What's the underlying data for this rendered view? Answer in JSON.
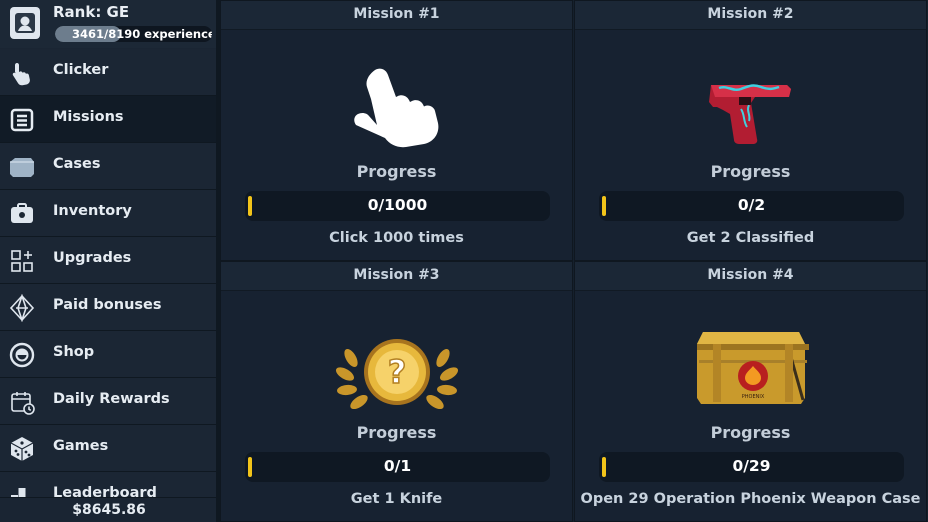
{
  "sidebar": {
    "rank": "Rank: GE",
    "xp_text": "3461/8190 experience",
    "xp_progress": 0.42,
    "items": [
      {
        "label": "Clicker",
        "icon": "hand-pointer-icon"
      },
      {
        "label": "Missions",
        "icon": "scroll-icon",
        "active": true
      },
      {
        "label": "Cases",
        "icon": "case-icon"
      },
      {
        "label": "Inventory",
        "icon": "inventory-icon"
      },
      {
        "label": "Upgrades",
        "icon": "upgrades-icon"
      },
      {
        "label": "Paid bonuses",
        "icon": "diamond-icon"
      },
      {
        "label": "Shop",
        "icon": "shop-icon"
      },
      {
        "label": "Daily Rewards",
        "icon": "calendar-icon"
      },
      {
        "label": "Games",
        "icon": "dice-icon"
      },
      {
        "label": "Leaderboard",
        "icon": "leaderboard-icon"
      }
    ],
    "balance": "$8645.86"
  },
  "missions": [
    {
      "title": "Mission #1",
      "progress_label": "Progress",
      "progress": "0/1000",
      "progress_value": 0,
      "description": "Click 1000 times",
      "image": "hand-pointer-icon"
    },
    {
      "title": "Mission #2",
      "progress_label": "Progress",
      "progress": "0/2",
      "progress_value": 0,
      "description": "Get 2 Classified",
      "image": "pistol-icon"
    },
    {
      "title": "Mission #3",
      "progress_label": "Progress",
      "progress": "0/1",
      "progress_value": 0,
      "description": "Get 1 Knife",
      "image": "mystery-medal-icon"
    },
    {
      "title": "Mission #4",
      "progress_label": "Progress",
      "progress": "0/29",
      "progress_value": 0,
      "description": "Open 29 Operation Phoenix Weapon Case",
      "image": "phoenix-case-icon"
    }
  ],
  "colors": {
    "accent": "#f2c41a",
    "background": "#15202d",
    "sidebar": "#1a2533"
  }
}
